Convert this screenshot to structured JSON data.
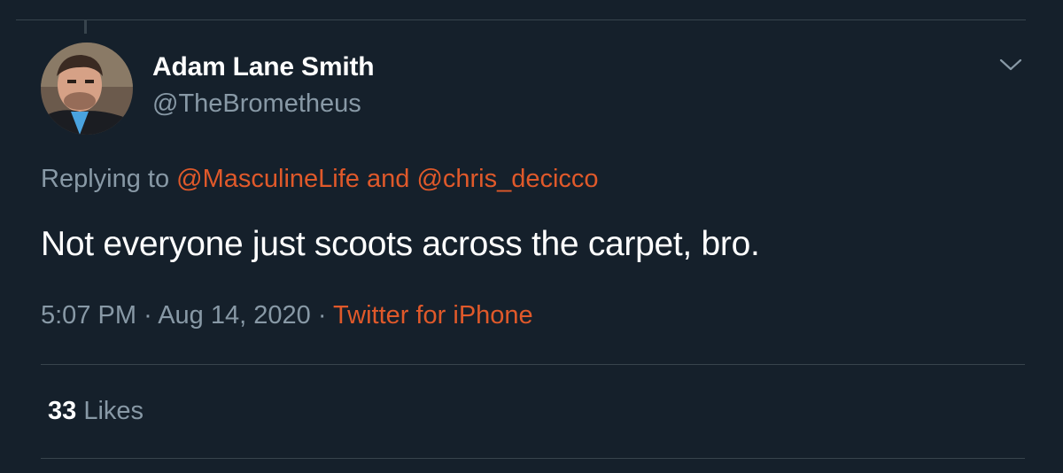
{
  "tweet": {
    "author": {
      "display_name": "Adam Lane Smith",
      "handle": "@TheBrometheus"
    },
    "replying_to": {
      "prefix": "Replying to",
      "users": [
        "@MasculineLife",
        "@chris_decicco"
      ],
      "conjunction": "and"
    },
    "text": "Not everyone just scoots across the carpet, bro.",
    "meta": {
      "time": "5:07 PM",
      "separator": "·",
      "date": "Aug 14, 2020",
      "source": "Twitter for iPhone"
    },
    "likes": {
      "count": "33",
      "label": "Likes"
    }
  },
  "icons": {
    "menu": "chevron-down-icon"
  },
  "colors": {
    "background": "#15202b",
    "accent": "#e0592a",
    "muted_text": "#8899a6",
    "primary_text": "#ffffff",
    "divider": "#38444d"
  }
}
